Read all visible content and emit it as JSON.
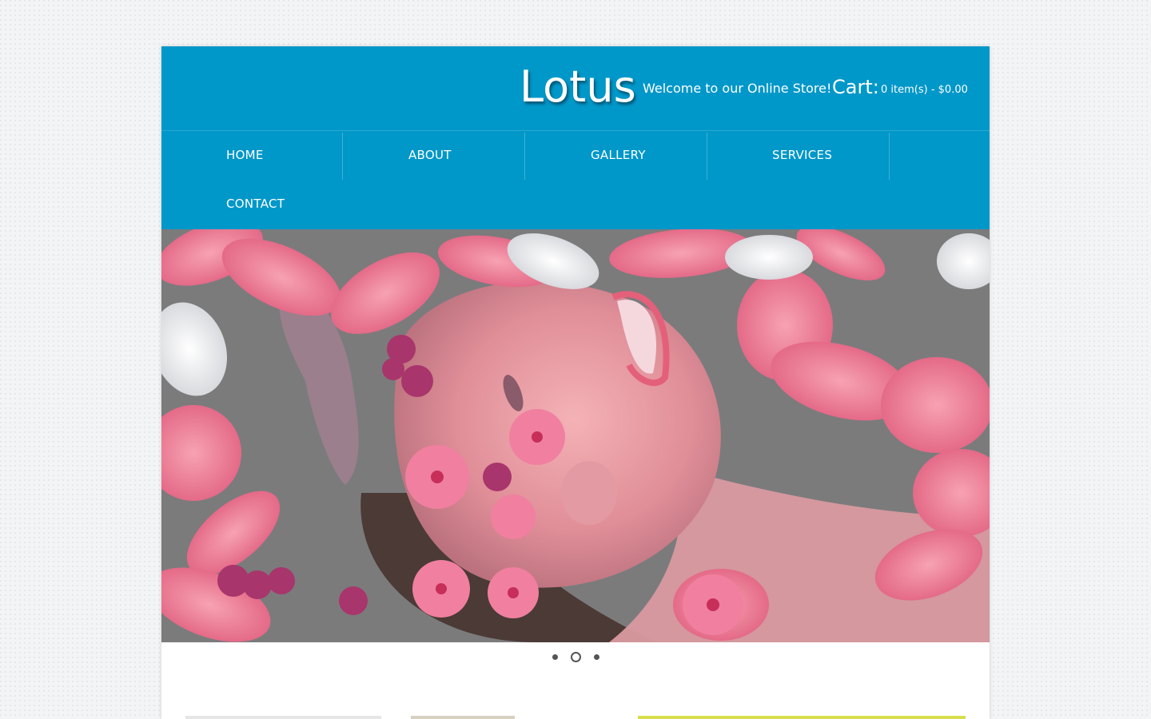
{
  "header": {
    "logo": "Lotus",
    "welcome": "Welcome to our Online Store!",
    "cart_label": "Cart:",
    "cart_summary": "0 item(s) - $0.00"
  },
  "nav": {
    "items": [
      {
        "label": "HOME"
      },
      {
        "label": "ABOUT"
      },
      {
        "label": "GALLERY"
      },
      {
        "label": "SERVICES"
      },
      {
        "label": "CONTACT"
      }
    ]
  },
  "slider": {
    "image": "woman-with-flowers-spa-photo",
    "slide_count": 3,
    "active_slide": 2
  },
  "colors": {
    "header_blue": "#0097c9",
    "nav_text": "#ffffff",
    "page_bg": "#f3f4f6"
  }
}
